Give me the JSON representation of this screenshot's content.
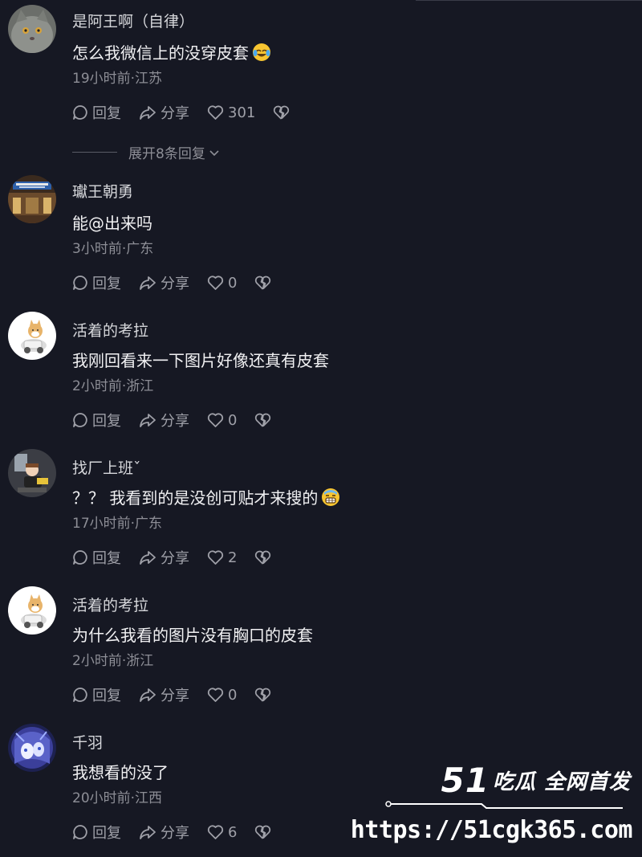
{
  "colors": {
    "background": "#161823",
    "text": "#f1f1f3",
    "secondary": "#8d8e96"
  },
  "comments": [
    {
      "username": "是阿王啊（自律）",
      "text": "怎么我微信上的没穿皮套",
      "emoji": "rolling-laughing-emoji",
      "meta": "19小时前·江苏",
      "reply_label": "回复",
      "share_label": "分享",
      "likes": "301",
      "avatar": "gray-cat-avatar"
    },
    {
      "username": "瓛王朝勇",
      "text": "能@出来吗",
      "meta": "3小时前·广东",
      "reply_label": "回复",
      "share_label": "分享",
      "likes": "0",
      "avatar": "storefront-avatar"
    },
    {
      "username": "活着的考拉",
      "text": "我刚回看来一下图片好像还真有皮套",
      "meta": "2小时前·浙江",
      "reply_label": "回复",
      "share_label": "分享",
      "likes": "0",
      "avatar": "shiba-dog-avatar"
    },
    {
      "username": "找厂上班ˇ",
      "text": "？？ 我看到的是没创可贴才来搜的",
      "emoji": "grimacing-sweat-emoji",
      "meta": "17小时前·广东",
      "reply_label": "回复",
      "share_label": "分享",
      "likes": "2",
      "avatar": "cartoon-worker-avatar"
    },
    {
      "username": "活着的考拉",
      "text": "为什么我看的图片没有胸口的皮套",
      "meta": "2小时前·浙江",
      "reply_label": "回复",
      "share_label": "分享",
      "likes": "0",
      "avatar": "shiba-dog-avatar"
    },
    {
      "username": "千羽",
      "text": "我想看的没了",
      "meta": "20小时前·江西",
      "reply_label": "回复",
      "share_label": "分享",
      "likes": "6",
      "avatar": "anime-girl-avatar"
    }
  ],
  "expand_replies": "展开8条回复",
  "watermark": {
    "number": "51",
    "title": "吃瓜 全网首发",
    "url": "https://51cgk365.com"
  }
}
